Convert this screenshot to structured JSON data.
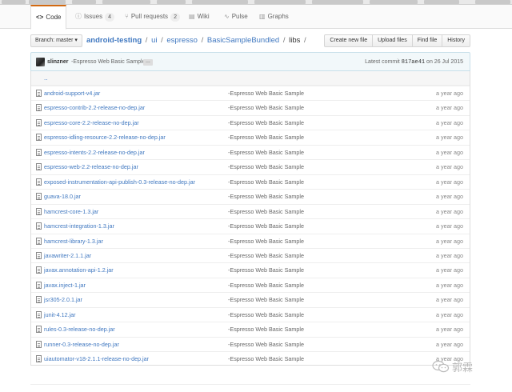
{
  "tabs": [
    {
      "label": "Code",
      "icon": "code-icon",
      "glyph": "<>",
      "selected": true
    },
    {
      "label": "Issues",
      "icon": "issue-icon",
      "glyph": "ⓘ",
      "count": "4"
    },
    {
      "label": "Pull requests",
      "icon": "pull-request-icon",
      "glyph": "⑂",
      "count": "2"
    },
    {
      "label": "Wiki",
      "icon": "wiki-icon",
      "glyph": "▤"
    },
    {
      "label": "Pulse",
      "icon": "pulse-icon",
      "glyph": "∿"
    },
    {
      "label": "Graphs",
      "icon": "graph-icon",
      "glyph": "▥"
    }
  ],
  "nav": {
    "branch_label": "Branch: master ▾",
    "breadcrumb": {
      "repo": "android-testing",
      "sep": "/",
      "parts": [
        "ui",
        "espresso",
        "BasicSampleBundled"
      ],
      "current": "libs"
    },
    "actions": [
      "Create new file",
      "Upload files",
      "Find file",
      "History"
    ]
  },
  "commit": {
    "author": "slinzner",
    "message": "-Espresso Web Basic Sample",
    "ellipsis": "...",
    "latest_prefix": "Latest commit",
    "sha": "817ae41",
    "date_prefix": "on",
    "date": "26 Jul 2015"
  },
  "parent_dir": "..",
  "files": [
    {
      "name": "android-support-v4.jar",
      "message": "-Espresso Web Basic Sample",
      "age": "a year ago"
    },
    {
      "name": "espresso-contrib-2.2-release-no-dep.jar",
      "message": "-Espresso Web Basic Sample",
      "age": "a year ago"
    },
    {
      "name": "espresso-core-2.2-release-no-dep.jar",
      "message": "-Espresso Web Basic Sample",
      "age": "a year ago"
    },
    {
      "name": "espresso-idling-resource-2.2-release-no-dep.jar",
      "message": "-Espresso Web Basic Sample",
      "age": "a year ago"
    },
    {
      "name": "espresso-intents-2.2-release-no-dep.jar",
      "message": "-Espresso Web Basic Sample",
      "age": "a year ago"
    },
    {
      "name": "espresso-web-2.2-release-no-dep.jar",
      "message": "-Espresso Web Basic Sample",
      "age": "a year ago"
    },
    {
      "name": "exposed-instrumentation-api-publish-0.3-release-no-dep.jar",
      "message": "-Espresso Web Basic Sample",
      "age": "a year ago"
    },
    {
      "name": "guava-18.0.jar",
      "message": "-Espresso Web Basic Sample",
      "age": "a year ago"
    },
    {
      "name": "hamcrest-core-1.3.jar",
      "message": "-Espresso Web Basic Sample",
      "age": "a year ago"
    },
    {
      "name": "hamcrest-integration-1.3.jar",
      "message": "-Espresso Web Basic Sample",
      "age": "a year ago"
    },
    {
      "name": "hamcrest-library-1.3.jar",
      "message": "-Espresso Web Basic Sample",
      "age": "a year ago"
    },
    {
      "name": "javawriter-2.1.1.jar",
      "message": "-Espresso Web Basic Sample",
      "age": "a year ago"
    },
    {
      "name": "javax.annotation-api-1.2.jar",
      "message": "-Espresso Web Basic Sample",
      "age": "a year ago"
    },
    {
      "name": "javax.inject-1.jar",
      "message": "-Espresso Web Basic Sample",
      "age": "a year ago"
    },
    {
      "name": "jsr305-2.0.1.jar",
      "message": "-Espresso Web Basic Sample",
      "age": "a year ago"
    },
    {
      "name": "junit-4.12.jar",
      "message": "-Espresso Web Basic Sample",
      "age": "a year ago"
    },
    {
      "name": "rules-0.3-release-no-dep.jar",
      "message": "-Espresso Web Basic Sample",
      "age": "a year ago"
    },
    {
      "name": "runner-0.3-release-no-dep.jar",
      "message": "-Espresso Web Basic Sample",
      "age": "a year ago"
    },
    {
      "name": "uiautomator-v18-2.1.1-release-no-dep.jar",
      "message": "-Espresso Web Basic Sample",
      "age": "a year ago"
    }
  ],
  "watermark": {
    "text": "郭霖",
    "icon": "wechat-icon"
  },
  "colors": {
    "link": "#4078c0",
    "tab_accent": "#d26911",
    "commit_bar": "#f2f8fa"
  }
}
